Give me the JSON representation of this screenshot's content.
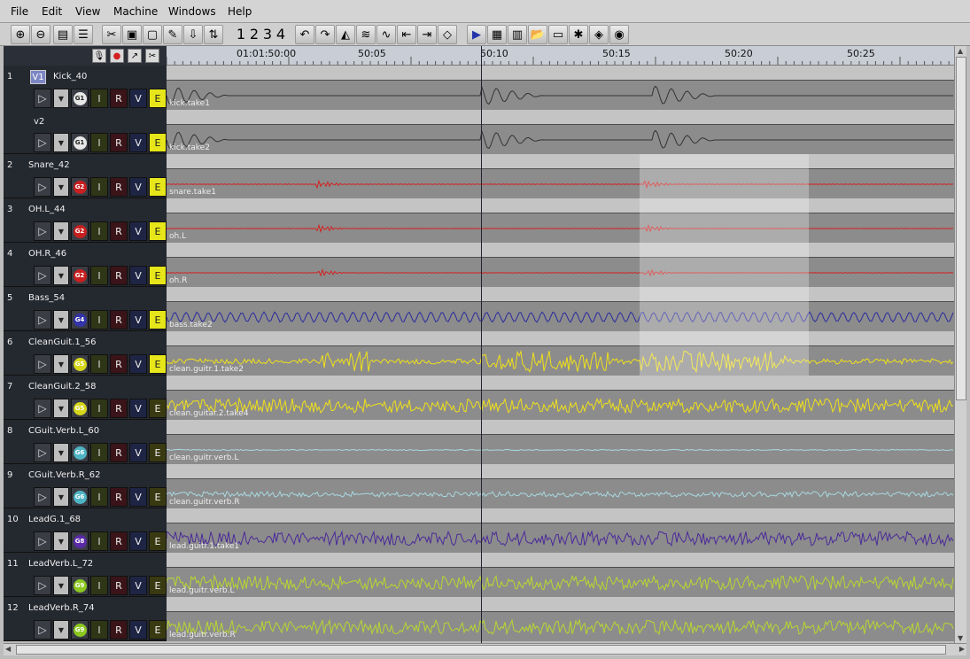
{
  "menu": {
    "items": [
      "File",
      "Edit",
      "View",
      "Machine",
      "Windows",
      "Help"
    ]
  },
  "toolbar": {
    "zoom_buttons": [
      "zoom-in-icon",
      "zoom-out-icon",
      "fit-tracks-icon",
      "expand-tracks-icon"
    ],
    "edit_buttons": [
      "scissors-icon",
      "paste-track-icon",
      "copy-track-icon",
      "pencil-icon",
      "insert-icon",
      "ripple-icon"
    ],
    "numbers": [
      "1",
      "2",
      "3",
      "4"
    ],
    "undo_icon": "undo-icon",
    "redo_icon": "redo-icon",
    "right_buttons": [
      "play-icon",
      "mixer-icon",
      "meter-icon",
      "open-folder-icon",
      "monitor-icon",
      "waveform-edit-icon",
      "layers-icon",
      "globe-icon"
    ]
  },
  "ruler": {
    "labels": [
      "01:01:50:00",
      "50:05",
      "50:10",
      "50:15",
      "50:20",
      "50:25"
    ]
  },
  "colors": {
    "accent_blue": "#2233aa",
    "waveform_gray": "#333333",
    "red": "#d42020",
    "blue": "#3333aa",
    "yellow": "#f0e11a",
    "cyan": "#a8d8e0",
    "purple": "#4b2a9a",
    "lime": "#b8d830"
  },
  "tracks": [
    {
      "num": "1",
      "name": "Kick_40",
      "versions": [
        {
          "label": "V1",
          "group": "G1",
          "clip": "kick.take1"
        },
        {
          "label": "v2",
          "group": "G1",
          "clip": "kick.take2"
        }
      ],
      "group_color": "#e8e8e8",
      "wave_color": "#333333",
      "edit_on": true
    },
    {
      "num": "2",
      "name": "Snare_42",
      "group": "G2",
      "clip": "snare.take1",
      "group_color": "#c82020",
      "wave_color": "#d42020",
      "edit_on": true
    },
    {
      "num": "3",
      "name": "OH.L_44",
      "group": "G2",
      "clip": "oh.L",
      "group_color": "#c82020",
      "wave_color": "#d42020",
      "edit_on": true
    },
    {
      "num": "4",
      "name": "OH.R_46",
      "group": "G2",
      "clip": "oh.R",
      "group_color": "#c82020",
      "wave_color": "#d42020",
      "edit_on": true
    },
    {
      "num": "5",
      "name": "Bass_54",
      "group": "G4",
      "clip": "bass.take2",
      "group_color": "#3333aa",
      "wave_color": "#2a2aa0",
      "edit_on": true
    },
    {
      "num": "6",
      "name": "CleanGuit.1_56",
      "group": "G5",
      "clip": "clean.guitr.1.take2",
      "group_color": "#d6d61a",
      "wave_color": "#f0e11a",
      "edit_on": true
    },
    {
      "num": "7",
      "name": "CleanGuit.2_58",
      "group": "G5",
      "clip": "clean.guitar.2.take4",
      "group_color": "#d6d61a",
      "wave_color": "#f0e11a",
      "edit_on": false
    },
    {
      "num": "8",
      "name": "CGuit.Verb.L_60",
      "group": "G6",
      "clip": "clean.guitr.verb.L",
      "group_color": "#4fb4c4",
      "wave_color": "#a8d8e0",
      "edit_on": false
    },
    {
      "num": "9",
      "name": "CGuit.Verb.R_62",
      "group": "G6",
      "clip": "clean.guitr.verb.R",
      "group_color": "#4fb4c4",
      "wave_color": "#a8d8e0",
      "edit_on": false
    },
    {
      "num": "10",
      "name": "LeadG.1_68",
      "group": "G8",
      "clip": "lead.guitr.1.take1",
      "group_color": "#5a2aa8",
      "wave_color": "#4b2a9a",
      "edit_on": false
    },
    {
      "num": "11",
      "name": "LeadVerb.L_72",
      "group": "G9",
      "clip": "lead.guitr.verb.L",
      "group_color": "#8cc820",
      "wave_color": "#b8d830",
      "edit_on": false
    },
    {
      "num": "12",
      "name": "LeadVerb.R_74",
      "group": "G9",
      "clip": "lead.guitr.verb.R",
      "group_color": "#8cc820",
      "wave_color": "#b8d830",
      "edit_on": false
    }
  ],
  "button_labels": {
    "input": "I",
    "record": "R",
    "volume": "V",
    "edit": "E"
  }
}
